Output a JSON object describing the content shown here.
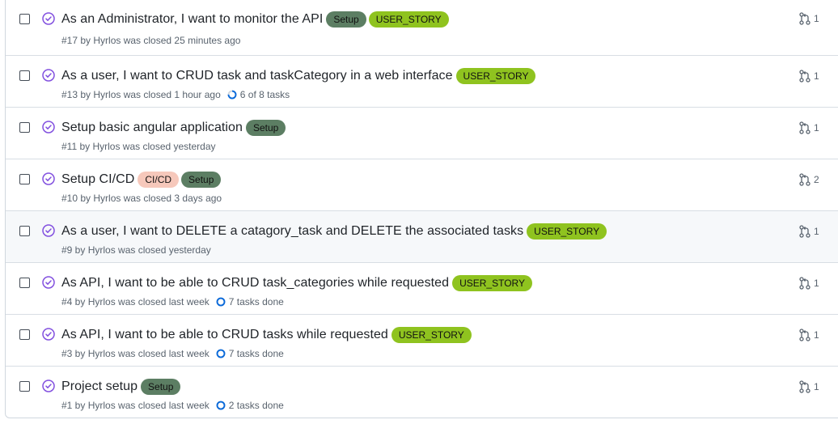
{
  "colors": {
    "closed_icon": "#8250df",
    "setup_label": "#5c7e63",
    "story_label": "#8fc31f",
    "cicd_label": "#f6c8bb",
    "progress_blue": "#0969da"
  },
  "issues": [
    {
      "title": "As an Administrator, I want to monitor the API",
      "labels": [
        {
          "text": "Setup"
        },
        {
          "text": "USER_STORY"
        }
      ],
      "meta": "#17 by Hyrlos was closed 25 minutes ago",
      "progress": "",
      "linked_prs": "1"
    },
    {
      "title": "As a user, I want to CRUD task and taskCategory in a web interface",
      "labels": [
        {
          "text": "USER_STORY"
        }
      ],
      "meta": "#13 by Hyrlos was closed 1 hour ago",
      "progress": "6 of 8 tasks",
      "progress_fraction": 0.75,
      "linked_prs": "1"
    },
    {
      "title": "Setup basic angular application",
      "labels": [
        {
          "text": "Setup"
        }
      ],
      "meta": "#11 by Hyrlos was closed yesterday",
      "progress": "",
      "linked_prs": "1"
    },
    {
      "title": "Setup CI/CD",
      "labels": [
        {
          "text": "CI/CD"
        },
        {
          "text": "Setup"
        }
      ],
      "meta": "#10 by Hyrlos was closed 3 days ago",
      "progress": "",
      "linked_prs": "2"
    },
    {
      "title": "As a user, I want to DELETE a catagory_task and DELETE the associated tasks",
      "labels": [
        {
          "text": "USER_STORY"
        }
      ],
      "meta": "#9 by Hyrlos was closed yesterday",
      "progress": "",
      "linked_prs": "1"
    },
    {
      "title": "As API, I want to be able to CRUD task_categories while requested",
      "labels": [
        {
          "text": "USER_STORY"
        }
      ],
      "meta": "#4 by Hyrlos was closed last week",
      "progress": "7 tasks done",
      "progress_fraction": 1,
      "linked_prs": "1"
    },
    {
      "title": "As API, I want to be able to CRUD tasks while requested",
      "labels": [
        {
          "text": "USER_STORY"
        }
      ],
      "meta": "#3 by Hyrlos was closed last week",
      "progress": "7 tasks done",
      "progress_fraction": 1,
      "linked_prs": "1"
    },
    {
      "title": "Project setup",
      "labels": [
        {
          "text": "Setup"
        }
      ],
      "meta": "#1 by Hyrlos was closed last week",
      "progress": "2 tasks done",
      "progress_fraction": 1,
      "linked_prs": "1"
    }
  ]
}
